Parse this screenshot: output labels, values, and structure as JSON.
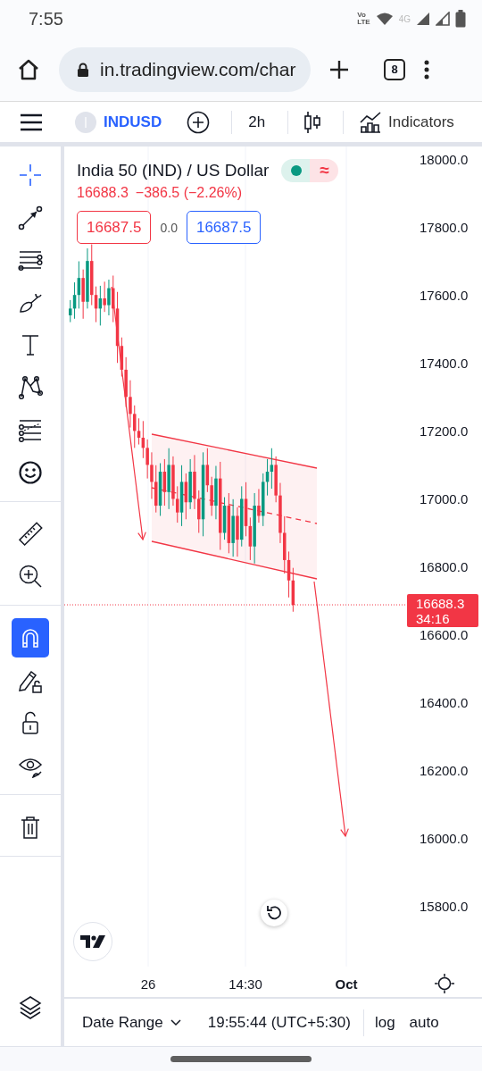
{
  "status_bar": {
    "time": "7:55",
    "volte": [
      "Vo",
      "LTE"
    ],
    "network": "4G"
  },
  "browser": {
    "url": "in.tradingview.com/char",
    "tab_count": "8"
  },
  "toolbar": {
    "symbol": "INDUSD",
    "interval": "2h",
    "indicators": "Indicators"
  },
  "left_toolbar": {
    "groups": [
      {
        "tools": [
          {
            "kind": "crosshair",
            "selected": true
          },
          {
            "kind": "trendline",
            "selected": false
          },
          {
            "kind": "fib",
            "selected": false
          },
          {
            "kind": "brush",
            "selected": false
          },
          {
            "kind": "text",
            "selected": false
          },
          {
            "kind": "pattern",
            "selected": false
          },
          {
            "kind": "forecast",
            "selected": false
          },
          {
            "kind": "emoji",
            "selected": false
          }
        ]
      },
      {
        "tools": [
          {
            "kind": "ruler",
            "selected": false
          },
          {
            "kind": "zoom",
            "selected": false
          }
        ]
      },
      {
        "tools": [
          {
            "kind": "magnet",
            "selected": true
          },
          {
            "kind": "lock-drawing",
            "selected": false
          },
          {
            "kind": "lock",
            "selected": false
          },
          {
            "kind": "hide",
            "selected": false
          }
        ]
      },
      {
        "tools": [
          {
            "kind": "trash",
            "selected": false
          }
        ]
      }
    ],
    "bottom_tool": {
      "kind": "layers"
    }
  },
  "chart": {
    "title": "India 50 (IND) / US Dollar",
    "status_symbol": "≈",
    "last": "16688.3",
    "change": "−386.5 (−2.26%)",
    "sell": "16687.5",
    "spread": "0.0",
    "buy": "16687.5",
    "price_axis": [
      "18000.0",
      "17800.0",
      "17600.0",
      "17400.0",
      "17200.0",
      "17000.0",
      "16800.0",
      "16600.0",
      "16400.0",
      "16200.0",
      "16000.0",
      "15800.0"
    ],
    "price_tag": {
      "price": "16688.3",
      "countdown": "34:16"
    },
    "time_axis": [
      {
        "label": "26",
        "bold": false
      },
      {
        "label": "14:30",
        "bold": false
      },
      {
        "label": "Oct",
        "bold": true
      }
    ]
  },
  "bottom_bar": {
    "date_range": "Date Range",
    "time": "19:55:44 (UTC+5:30)",
    "scales": [
      "log",
      "auto"
    ]
  }
}
